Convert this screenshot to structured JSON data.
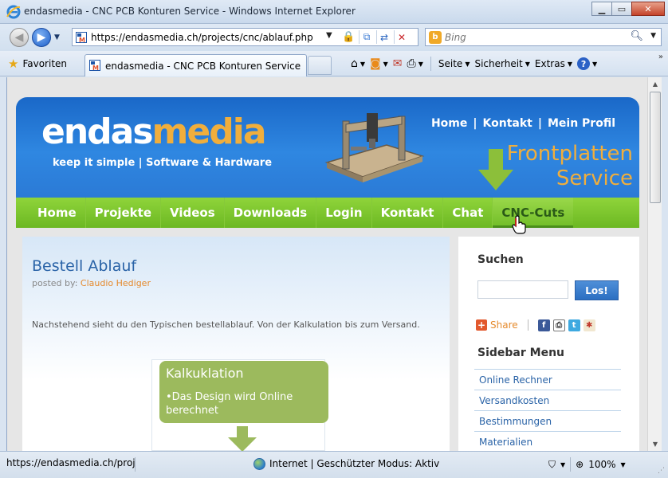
{
  "window": {
    "title": "endasmedia - CNC PCB Konturen Service - Windows Internet Explorer"
  },
  "address": {
    "url": "https://endasmedia.ch/projects/cnc/ablauf.php",
    "search_placeholder": "Bing"
  },
  "command_bar": {
    "favorites_label": "Favoriten",
    "tab_label": "endasmedia - CNC PCB Konturen Service",
    "page_label": "Seite",
    "safety_label": "Sicherheit",
    "extras_label": "Extras",
    "help_label": "?"
  },
  "site": {
    "logo_part1": "endas",
    "logo_part2": "media",
    "slogan": "keep it simple | Software & Hardware",
    "top_links": [
      "Home",
      "Kontakt",
      "Mein Profil"
    ],
    "banner_line1": "Frontplatten",
    "banner_line2": "Service",
    "nav": [
      "Home",
      "Projekte",
      "Videos",
      "Downloads",
      "Login",
      "Kontakt",
      "Chat",
      "CNC-Cuts"
    ]
  },
  "post": {
    "title": "Bestell Ablauf",
    "posted_by_label": "posted by:",
    "author": "Claudio Hediger",
    "intro": "Nachstehend sieht du den Typischen bestellablauf. Von der Kalkulation bis zum Versand.",
    "diagram_title": "Kalkuklation",
    "diagram_text": "•Das Design wird Online berechnet"
  },
  "sidebar": {
    "search_title": "Suchen",
    "search_button": "Los!",
    "share_label": "Share",
    "menu_title": "Sidebar Menu",
    "menu_items": [
      "Online Rechner",
      "Versandkosten",
      "Bestimmungen",
      "Materialien"
    ]
  },
  "status": {
    "url_preview": "https://endasmedia.ch/projects/cnc/ablauf.php",
    "zone": "Internet | Geschützter Modus: Aktiv",
    "zoom": "100%"
  },
  "colors": {
    "header_blue": "#2f87e1",
    "nav_green": "#7cc52d",
    "accent_orange": "#f0ae3c",
    "link_blue": "#2a63a7"
  }
}
